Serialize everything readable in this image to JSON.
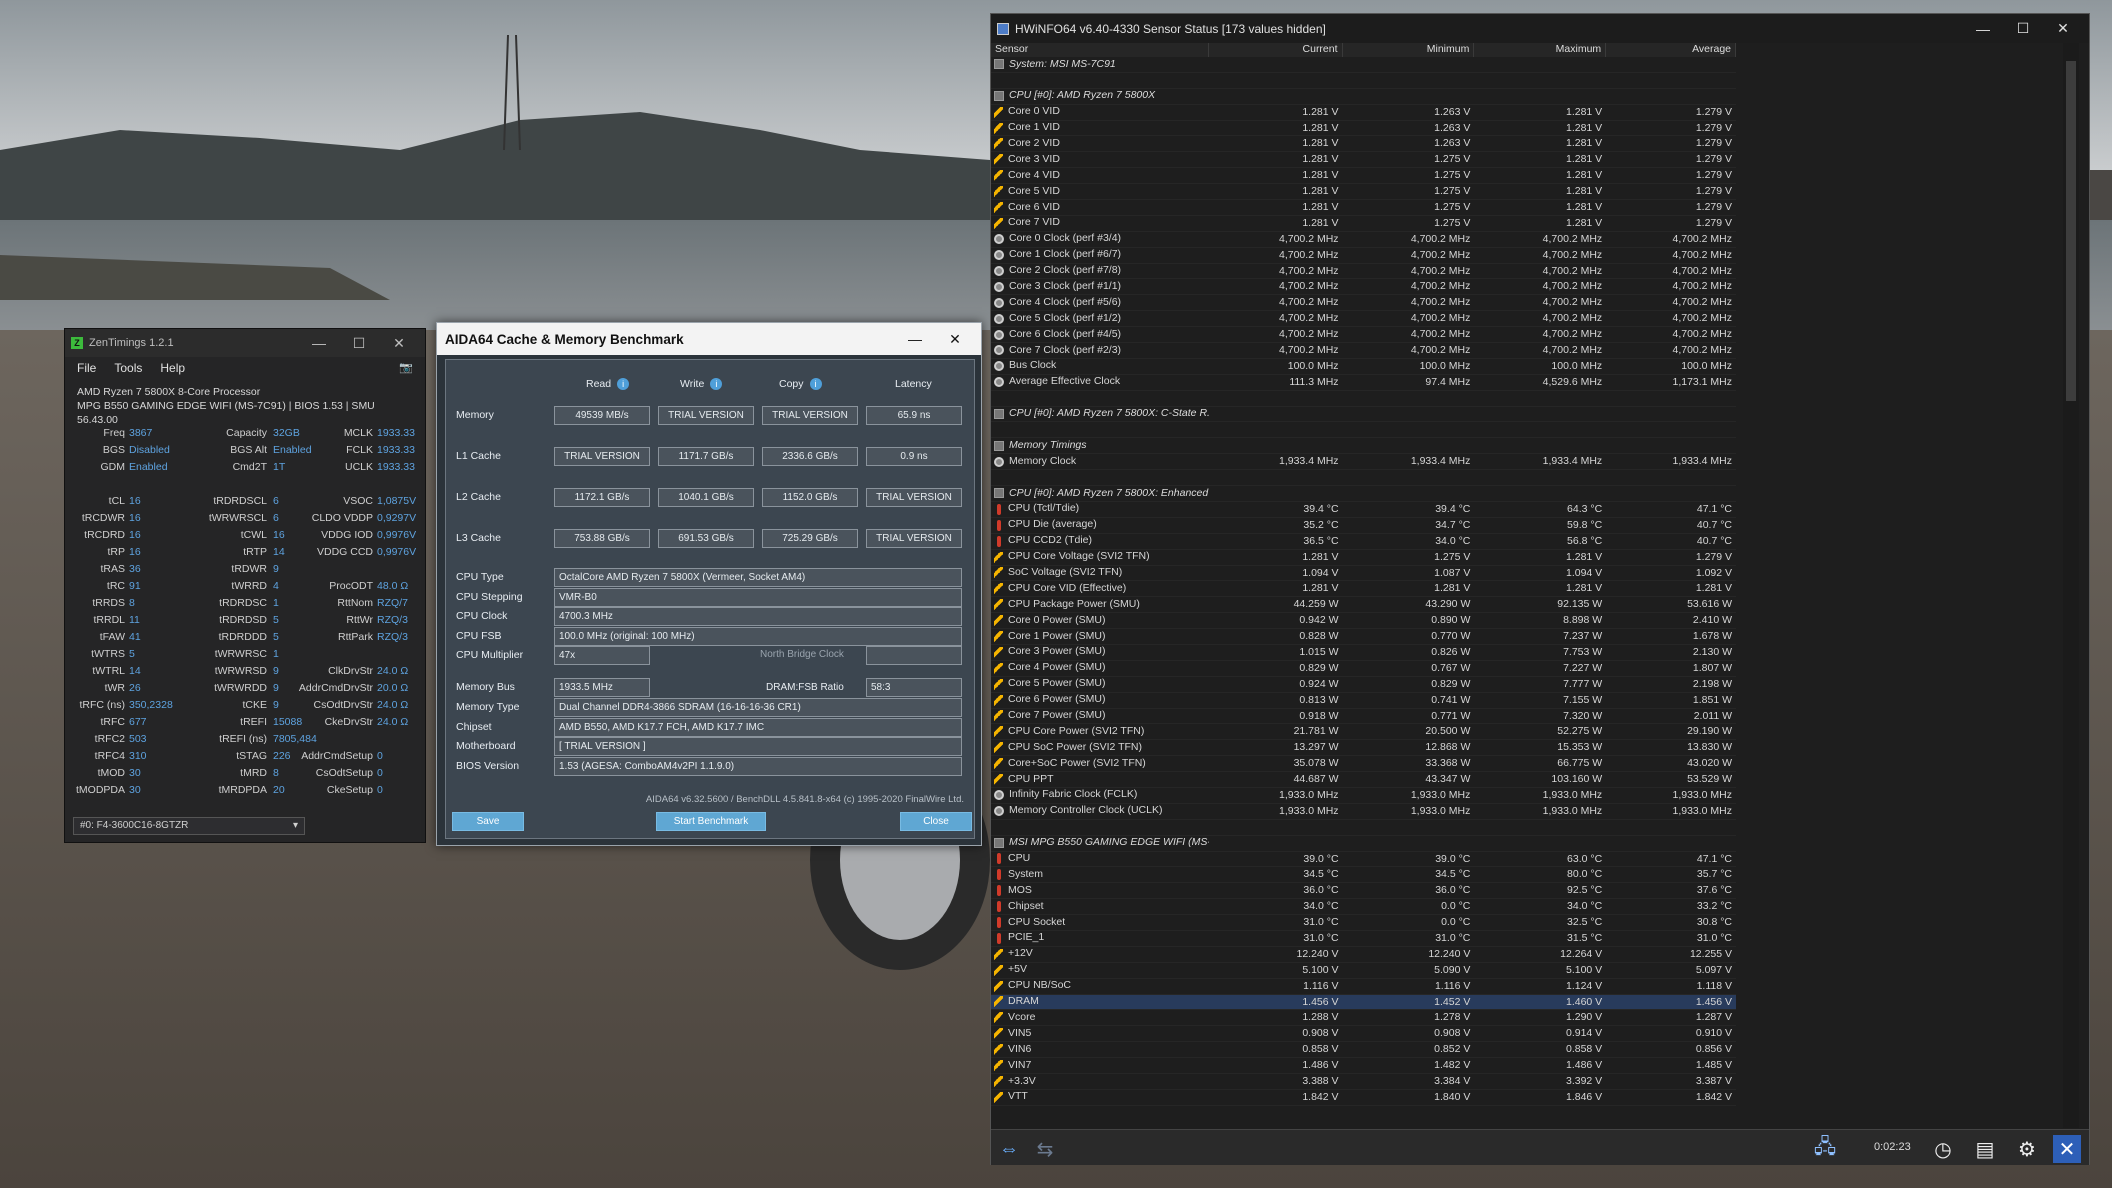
{
  "zentimings": {
    "title": "ZenTimings 1.2.1",
    "menu": [
      "File",
      "Tools",
      "Help"
    ],
    "cpu": "AMD Ryzen 7 5800X 8-Core Processor",
    "board": "MPG B550 GAMING EDGE WIFI (MS-7C91) | BIOS 1.53 | SMU 56.43.00",
    "top_rows": [
      [
        "Freq",
        "3867",
        "Capacity",
        "32GB",
        "MCLK",
        "1933.33"
      ],
      [
        "BGS",
        "Disabled",
        "BGS Alt",
        "Enabled",
        "FCLK",
        "1933.33"
      ],
      [
        "GDM",
        "Enabled",
        "Cmd2T",
        "1T",
        "UCLK",
        "1933.33"
      ]
    ],
    "timing_rows": [
      [
        "tCL",
        "16",
        "tRDRDSCL",
        "6",
        "VSOC",
        "1,0875V"
      ],
      [
        "tRCDWR",
        "16",
        "tWRWRSCL",
        "6",
        "CLDO VDDP",
        "0,9297V"
      ],
      [
        "tRCDRD",
        "16",
        "tCWL",
        "16",
        "VDDG IOD",
        "0,9976V"
      ],
      [
        "tRP",
        "16",
        "tRTP",
        "14",
        "VDDG CCD",
        "0,9976V"
      ],
      [
        "tRAS",
        "36",
        "tRDWR",
        "9",
        "",
        ""
      ],
      [
        "tRC",
        "91",
        "tWRRD",
        "4",
        "ProcODT",
        "48.0 Ω"
      ],
      [
        "tRRDS",
        "8",
        "tRDRDSC",
        "1",
        "RttNom",
        "RZQ/7"
      ],
      [
        "tRRDL",
        "11",
        "tRDRDSD",
        "5",
        "RttWr",
        "RZQ/3"
      ],
      [
        "tFAW",
        "41",
        "tRDRDDD",
        "5",
        "RttPark",
        "RZQ/3"
      ],
      [
        "tWTRS",
        "5",
        "tWRWRSC",
        "1",
        "",
        ""
      ],
      [
        "tWTRL",
        "14",
        "tWRWRSD",
        "9",
        "ClkDrvStr",
        "24.0 Ω"
      ],
      [
        "tWR",
        "26",
        "tWRWRDD",
        "9",
        "AddrCmdDrvStr",
        "20.0 Ω"
      ],
      [
        "tRFC (ns)",
        "350,2328",
        "tCKE",
        "9",
        "CsOdtDrvStr",
        "24.0 Ω"
      ],
      [
        "tRFC",
        "677",
        "tREFI",
        "15088",
        "CkeDrvStr",
        "24.0 Ω"
      ],
      [
        "tRFC2",
        "503",
        "tREFI (ns)",
        "7805,484",
        "",
        ""
      ],
      [
        "tRFC4",
        "310",
        "tSTAG",
        "226",
        "AddrCmdSetup",
        "0"
      ],
      [
        "tMOD",
        "30",
        "tMRD",
        "8",
        "CsOdtSetup",
        "0"
      ],
      [
        "tMODPDA",
        "30",
        "tMRDPDA",
        "20",
        "CkeSetup",
        "0"
      ]
    ],
    "profile": "#0: F4-3600C16-8GTZR"
  },
  "aida": {
    "title": "AIDA64 Cache & Memory Benchmark",
    "headers": [
      "Read",
      "Write",
      "Copy",
      "Latency"
    ],
    "rows": [
      {
        "label": "Memory",
        "vals": [
          "49539 MB/s",
          "TRIAL VERSION",
          "TRIAL VERSION",
          "65.9 ns"
        ]
      },
      {
        "label": "L1 Cache",
        "vals": [
          "TRIAL VERSION",
          "1171.7 GB/s",
          "2336.6 GB/s",
          "0.9 ns"
        ]
      },
      {
        "label": "L2 Cache",
        "vals": [
          "1172.1 GB/s",
          "1040.1 GB/s",
          "1152.0 GB/s",
          "TRIAL VERSION"
        ]
      },
      {
        "label": "L3 Cache",
        "vals": [
          "753.88 GB/s",
          "691.53 GB/s",
          "725.29 GB/s",
          "TRIAL VERSION"
        ]
      }
    ],
    "info": [
      {
        "label": "CPU Type",
        "value": "OctalCore AMD Ryzen 7 5800X  (Vermeer, Socket AM4)"
      },
      {
        "label": "CPU Stepping",
        "value": "VMR-B0"
      },
      {
        "label": "CPU Clock",
        "value": "4700.3 MHz"
      },
      {
        "label": "CPU FSB",
        "value": "100.0 MHz  (original: 100 MHz)"
      },
      {
        "label": "CPU Multiplier",
        "value": "47x"
      }
    ],
    "nb_label": "North Bridge Clock",
    "membus_label": "Memory Bus",
    "membus": "1933.5 MHz",
    "ratio_label": "DRAM:FSB Ratio",
    "ratio": "58:3",
    "info2": [
      {
        "label": "Memory Type",
        "value": "Dual Channel DDR4-3866 SDRAM  (16-16-16-36 CR1)"
      },
      {
        "label": "Chipset",
        "value": "AMD B550, AMD K17.7 FCH, AMD K17.7 IMC"
      },
      {
        "label": "Motherboard",
        "value": "[ TRIAL VERSION ]"
      },
      {
        "label": "BIOS Version",
        "value": "1.53  (AGESA: ComboAM4v2PI 1.1.9.0)"
      }
    ],
    "footer": "AIDA64 v6.32.5600 / BenchDLL 4.5.841.8-x64  (c) 1995-2020 FinalWire Ltd.",
    "buttons": {
      "save": "Save",
      "start": "Start Benchmark",
      "close": "Close"
    }
  },
  "hwinfo": {
    "title": "HWiNFO64 v6.40-4330 Sensor Status [173 values hidden]",
    "headers": [
      "Sensor",
      "Current",
      "Minimum",
      "Maximum",
      "Average"
    ],
    "timer": "0:02:23",
    "rows": [
      {
        "k": "g",
        "n": "System: MSI MS-7C91"
      },
      {
        "k": "e"
      },
      {
        "k": "g",
        "n": "CPU [#0]: AMD Ryzen 7 5800X"
      },
      {
        "k": "v",
        "n": "Core 0 VID",
        "v": [
          "1.281 V",
          "1.263 V",
          "1.281 V",
          "1.279 V"
        ]
      },
      {
        "k": "v",
        "n": "Core 1 VID",
        "v": [
          "1.281 V",
          "1.263 V",
          "1.281 V",
          "1.279 V"
        ]
      },
      {
        "k": "v",
        "n": "Core 2 VID",
        "v": [
          "1.281 V",
          "1.263 V",
          "1.281 V",
          "1.279 V"
        ]
      },
      {
        "k": "v",
        "n": "Core 3 VID",
        "v": [
          "1.281 V",
          "1.275 V",
          "1.281 V",
          "1.279 V"
        ]
      },
      {
        "k": "v",
        "n": "Core 4 VID",
        "v": [
          "1.281 V",
          "1.275 V",
          "1.281 V",
          "1.279 V"
        ]
      },
      {
        "k": "v",
        "n": "Core 5 VID",
        "v": [
          "1.281 V",
          "1.275 V",
          "1.281 V",
          "1.279 V"
        ]
      },
      {
        "k": "v",
        "n": "Core 6 VID",
        "v": [
          "1.281 V",
          "1.275 V",
          "1.281 V",
          "1.279 V"
        ]
      },
      {
        "k": "v",
        "n": "Core 7 VID",
        "v": [
          "1.281 V",
          "1.275 V",
          "1.281 V",
          "1.279 V"
        ]
      },
      {
        "k": "c",
        "n": "Core 0 Clock (perf #3/4)",
        "v": [
          "4,700.2 MHz",
          "4,700.2 MHz",
          "4,700.2 MHz",
          "4,700.2 MHz"
        ]
      },
      {
        "k": "c",
        "n": "Core 1 Clock (perf #6/7)",
        "v": [
          "4,700.2 MHz",
          "4,700.2 MHz",
          "4,700.2 MHz",
          "4,700.2 MHz"
        ]
      },
      {
        "k": "c",
        "n": "Core 2 Clock (perf #7/8)",
        "v": [
          "4,700.2 MHz",
          "4,700.2 MHz",
          "4,700.2 MHz",
          "4,700.2 MHz"
        ]
      },
      {
        "k": "c",
        "n": "Core 3 Clock (perf #1/1)",
        "v": [
          "4,700.2 MHz",
          "4,700.2 MHz",
          "4,700.2 MHz",
          "4,700.2 MHz"
        ]
      },
      {
        "k": "c",
        "n": "Core 4 Clock (perf #5/6)",
        "v": [
          "4,700.2 MHz",
          "4,700.2 MHz",
          "4,700.2 MHz",
          "4,700.2 MHz"
        ]
      },
      {
        "k": "c",
        "n": "Core 5 Clock (perf #1/2)",
        "v": [
          "4,700.2 MHz",
          "4,700.2 MHz",
          "4,700.2 MHz",
          "4,700.2 MHz"
        ]
      },
      {
        "k": "c",
        "n": "Core 6 Clock (perf #4/5)",
        "v": [
          "4,700.2 MHz",
          "4,700.2 MHz",
          "4,700.2 MHz",
          "4,700.2 MHz"
        ]
      },
      {
        "k": "c",
        "n": "Core 7 Clock (perf #2/3)",
        "v": [
          "4,700.2 MHz",
          "4,700.2 MHz",
          "4,700.2 MHz",
          "4,700.2 MHz"
        ]
      },
      {
        "k": "c",
        "n": "Bus Clock",
        "v": [
          "100.0 MHz",
          "100.0 MHz",
          "100.0 MHz",
          "100.0 MHz"
        ]
      },
      {
        "k": "c",
        "n": "Average Effective Clock",
        "v": [
          "111.3 MHz",
          "97.4 MHz",
          "4,529.6 MHz",
          "1,173.1 MHz"
        ]
      },
      {
        "k": "e"
      },
      {
        "k": "g",
        "n": "CPU [#0]: AMD Ryzen 7 5800X: C-State R..."
      },
      {
        "k": "e"
      },
      {
        "k": "g",
        "n": "Memory Timings"
      },
      {
        "k": "c",
        "n": "Memory Clock",
        "v": [
          "1,933.4 MHz",
          "1,933.4 MHz",
          "1,933.4 MHz",
          "1,933.4 MHz"
        ]
      },
      {
        "k": "e"
      },
      {
        "k": "g",
        "n": "CPU [#0]: AMD Ryzen 7 5800X: Enhanced"
      },
      {
        "k": "t",
        "n": "CPU (Tctl/Tdie)",
        "v": [
          "39.4 °C",
          "39.4 °C",
          "64.3 °C",
          "47.1 °C"
        ]
      },
      {
        "k": "t",
        "n": "CPU Die (average)",
        "v": [
          "35.2 °C",
          "34.7 °C",
          "59.8 °C",
          "40.7 °C"
        ]
      },
      {
        "k": "t",
        "n": "CPU CCD2 (Tdie)",
        "v": [
          "36.5 °C",
          "34.0 °C",
          "56.8 °C",
          "40.7 °C"
        ]
      },
      {
        "k": "v",
        "n": "CPU Core Voltage (SVI2 TFN)",
        "v": [
          "1.281 V",
          "1.275 V",
          "1.281 V",
          "1.279 V"
        ]
      },
      {
        "k": "v",
        "n": "SoC Voltage (SVI2 TFN)",
        "v": [
          "1.094 V",
          "1.087 V",
          "1.094 V",
          "1.092 V"
        ]
      },
      {
        "k": "v",
        "n": "CPU Core VID (Effective)",
        "v": [
          "1.281 V",
          "1.281 V",
          "1.281 V",
          "1.281 V"
        ]
      },
      {
        "k": "v",
        "n": "CPU Package Power (SMU)",
        "v": [
          "44.259 W",
          "43.290 W",
          "92.135 W",
          "53.616 W"
        ]
      },
      {
        "k": "v",
        "n": "Core 0 Power (SMU)",
        "v": [
          "0.942 W",
          "0.890 W",
          "8.898 W",
          "2.410 W"
        ]
      },
      {
        "k": "v",
        "n": "Core 1 Power (SMU)",
        "v": [
          "0.828 W",
          "0.770 W",
          "7.237 W",
          "1.678 W"
        ]
      },
      {
        "k": "v",
        "n": "Core 3 Power (SMU)",
        "v": [
          "1.015 W",
          "0.826 W",
          "7.753 W",
          "2.130 W"
        ]
      },
      {
        "k": "v",
        "n": "Core 4 Power (SMU)",
        "v": [
          "0.829 W",
          "0.767 W",
          "7.227 W",
          "1.807 W"
        ]
      },
      {
        "k": "v",
        "n": "Core 5 Power (SMU)",
        "v": [
          "0.924 W",
          "0.829 W",
          "7.777 W",
          "2.198 W"
        ]
      },
      {
        "k": "v",
        "n": "Core 6 Power (SMU)",
        "v": [
          "0.813 W",
          "0.741 W",
          "7.155 W",
          "1.851 W"
        ]
      },
      {
        "k": "v",
        "n": "Core 7 Power (SMU)",
        "v": [
          "0.918 W",
          "0.771 W",
          "7.320 W",
          "2.011 W"
        ]
      },
      {
        "k": "v",
        "n": "CPU Core Power (SVI2 TFN)",
        "v": [
          "21.781 W",
          "20.500 W",
          "52.275 W",
          "29.190 W"
        ]
      },
      {
        "k": "v",
        "n": "CPU SoC Power (SVI2 TFN)",
        "v": [
          "13.297 W",
          "12.868 W",
          "15.353 W",
          "13.830 W"
        ]
      },
      {
        "k": "v",
        "n": "Core+SoC Power (SVI2 TFN)",
        "v": [
          "35.078 W",
          "33.368 W",
          "66.775 W",
          "43.020 W"
        ]
      },
      {
        "k": "v",
        "n": "CPU PPT",
        "v": [
          "44.687 W",
          "43.347 W",
          "103.160 W",
          "53.529 W"
        ]
      },
      {
        "k": "c",
        "n": "Infinity Fabric Clock (FCLK)",
        "v": [
          "1,933.0 MHz",
          "1,933.0 MHz",
          "1,933.0 MHz",
          "1,933.0 MHz"
        ]
      },
      {
        "k": "c",
        "n": "Memory Controller Clock (UCLK)",
        "v": [
          "1,933.0 MHz",
          "1,933.0 MHz",
          "1,933.0 MHz",
          "1,933.0 MHz"
        ]
      },
      {
        "k": "e"
      },
      {
        "k": "g",
        "n": "MSI MPG B550 GAMING EDGE WIFI (MS-..."
      },
      {
        "k": "t",
        "n": "CPU",
        "v": [
          "39.0 °C",
          "39.0 °C",
          "63.0 °C",
          "47.1 °C"
        ]
      },
      {
        "k": "t",
        "n": "System",
        "v": [
          "34.5 °C",
          "34.5 °C",
          "80.0 °C",
          "35.7 °C"
        ]
      },
      {
        "k": "t",
        "n": "MOS",
        "v": [
          "36.0 °C",
          "36.0 °C",
          "92.5 °C",
          "37.6 °C"
        ]
      },
      {
        "k": "t",
        "n": "Chipset",
        "v": [
          "34.0 °C",
          "0.0 °C",
          "34.0 °C",
          "33.2 °C"
        ]
      },
      {
        "k": "t",
        "n": "CPU Socket",
        "v": [
          "31.0 °C",
          "0.0 °C",
          "32.5 °C",
          "30.8 °C"
        ]
      },
      {
        "k": "t",
        "n": "PCIE_1",
        "v": [
          "31.0 °C",
          "31.0 °C",
          "31.5 °C",
          "31.0 °C"
        ]
      },
      {
        "k": "v",
        "n": "+12V",
        "v": [
          "12.240 V",
          "12.240 V",
          "12.264 V",
          "12.255 V"
        ]
      },
      {
        "k": "v",
        "n": "+5V",
        "v": [
          "5.100 V",
          "5.090 V",
          "5.100 V",
          "5.097 V"
        ]
      },
      {
        "k": "v",
        "n": "CPU NB/SoC",
        "v": [
          "1.116 V",
          "1.116 V",
          "1.124 V",
          "1.118 V"
        ]
      },
      {
        "k": "v",
        "n": "DRAM",
        "v": [
          "1.456 V",
          "1.452 V",
          "1.460 V",
          "1.456 V"
        ],
        "sel": true
      },
      {
        "k": "v",
        "n": "Vcore",
        "v": [
          "1.288 V",
          "1.278 V",
          "1.290 V",
          "1.287 V"
        ]
      },
      {
        "k": "v",
        "n": "VIN5",
        "v": [
          "0.908 V",
          "0.908 V",
          "0.914 V",
          "0.910 V"
        ]
      },
      {
        "k": "v",
        "n": "VIN6",
        "v": [
          "0.858 V",
          "0.852 V",
          "0.858 V",
          "0.856 V"
        ]
      },
      {
        "k": "v",
        "n": "VIN7",
        "v": [
          "1.486 V",
          "1.482 V",
          "1.486 V",
          "1.485 V"
        ]
      },
      {
        "k": "v",
        "n": "+3.3V",
        "v": [
          "3.388 V",
          "3.384 V",
          "3.392 V",
          "3.387 V"
        ]
      },
      {
        "k": "v",
        "n": "VTT",
        "v": [
          "1.842 V",
          "1.840 V",
          "1.846 V",
          "1.842 V"
        ]
      }
    ]
  }
}
